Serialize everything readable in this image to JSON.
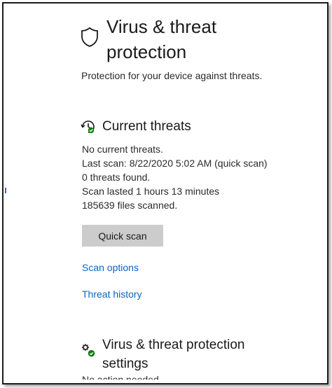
{
  "header": {
    "icon": "shield-icon",
    "title": "Virus & threat protection",
    "subtitle": "Protection for your device against threats."
  },
  "current_threats": {
    "icon": "threat-clock-icon",
    "title": "Current threats",
    "status": "No current threats.",
    "last_scan": "Last scan: 8/22/2020 5:02 AM (quick scan)",
    "threats_found": "0 threats found.",
    "scan_duration": "Scan lasted 1 hours 13 minutes",
    "files_scanned": "185639 files scanned.",
    "quick_scan_label": "Quick scan",
    "scan_options_label": "Scan options",
    "threat_history_label": "Threat history"
  },
  "settings_section": {
    "icon": "settings-gears-icon",
    "title": "Virus & threat protection settings",
    "truncated_line": "No action needed."
  },
  "colors": {
    "link": "#0a64c2",
    "button_bg": "#cccccc",
    "status_ok": "#107c10",
    "frame_border": "#1c1c1c"
  }
}
